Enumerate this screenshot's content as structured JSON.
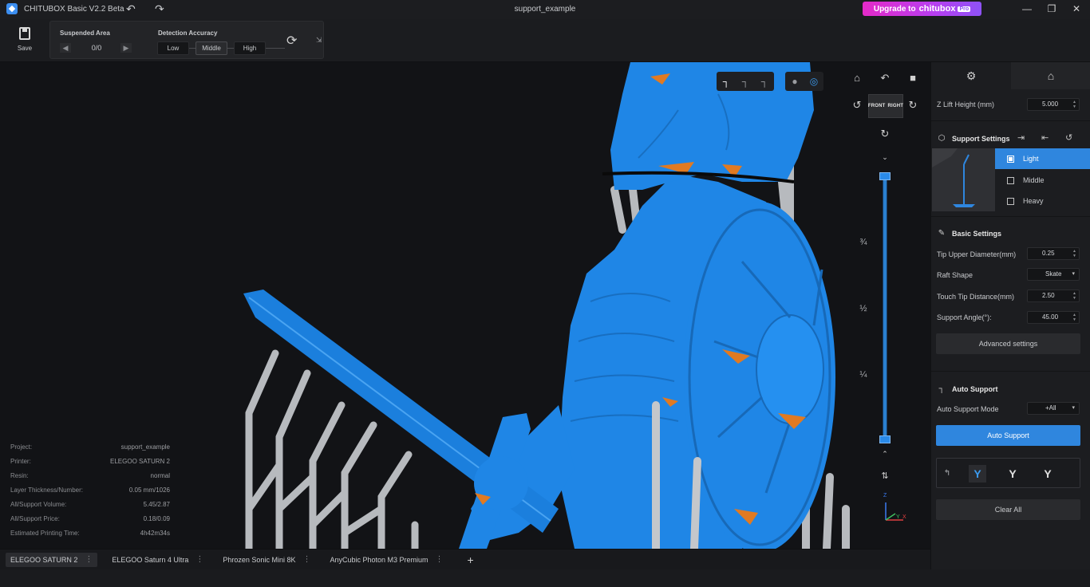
{
  "titlebar": {
    "app_title": "CHITUBOX Basic V2.2 Beta",
    "document": "support_example",
    "upgrade_prefix": "Upgrade to",
    "upgrade_brand": "chitubox",
    "upgrade_tier": "Pro",
    "undo_icon": "undo-icon",
    "redo_icon": "redo-icon"
  },
  "toolbar": {
    "save_label": "Save",
    "suspended_area": {
      "title": "Suspended Area",
      "count": "0/0"
    },
    "detection": {
      "title": "Detection Accuracy",
      "options": [
        "Low",
        "Middle",
        "High"
      ],
      "selected": "Middle"
    }
  },
  "viewport": {
    "cube_faces": [
      "FRONT",
      "RIGHT"
    ],
    "layer_marks": [
      "¾",
      "½",
      "¼"
    ],
    "axes": [
      "Z",
      "Y",
      "X"
    ],
    "colors": {
      "model": "#1f86e6",
      "support": "#b9bcc0",
      "accent": "#2f86de"
    },
    "info": [
      {
        "label": "Project:",
        "value": "support_example"
      },
      {
        "label": "Printer:",
        "value": "ELEGOO SATURN 2"
      },
      {
        "label": "Resin:",
        "value": "normal"
      },
      {
        "label": "Layer Thickness/Number:",
        "value": "0.05 mm/1026"
      },
      {
        "label": "All/Support Volume:",
        "value": "5.45/2.87"
      },
      {
        "label": "All/Support Price:",
        "value": "0.18/0.09"
      },
      {
        "label": "Estimated Printing Time:",
        "value": "4h42m34s"
      }
    ]
  },
  "printer_tabs": [
    {
      "label": "ELEGOO SATURN 2",
      "active": true
    },
    {
      "label": "ELEGOO Saturn 4 Ultra",
      "active": false
    },
    {
      "label": "Phrozen Sonic Mini 8K",
      "active": false
    },
    {
      "label": "AnyCubic Photon M3 Premium",
      "active": false
    }
  ],
  "panel": {
    "z_lift": {
      "label": "Z Lift Height (mm)",
      "value": "5.000"
    },
    "support_settings": {
      "title": "Support Settings",
      "presets": [
        "Light",
        "Middle",
        "Heavy"
      ],
      "selected": "Light"
    },
    "basic_settings": {
      "title": "Basic Settings",
      "tip_upper": {
        "label": "Tip Upper Diameter(mm)",
        "value": "0.25"
      },
      "raft_shape": {
        "label": "Raft Shape",
        "value": "Skate"
      },
      "touch_tip": {
        "label": "Touch Tip Distance(mm)",
        "value": "2.50"
      },
      "support_angle": {
        "label": "Support Angle(°):",
        "value": "45.00"
      },
      "advanced": "Advanced settings"
    },
    "auto_support": {
      "title": "Auto Support",
      "mode_label": "Auto Support Mode",
      "mode_value": "+All",
      "button": "Auto Support",
      "clear_all": "Clear All"
    }
  }
}
